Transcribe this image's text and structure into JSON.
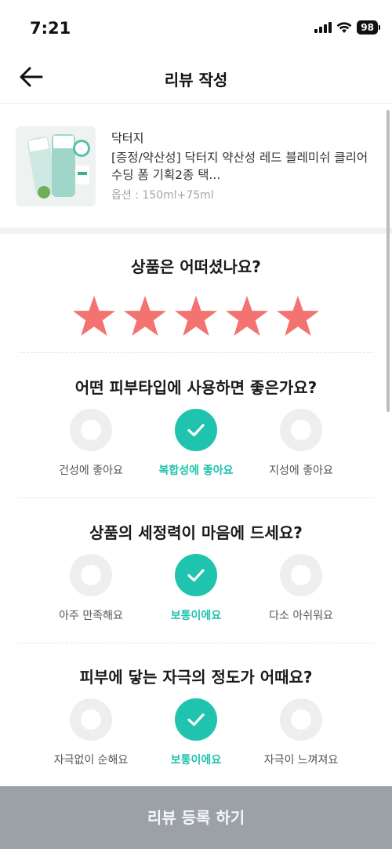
{
  "status": {
    "time": "7:21",
    "battery": "98"
  },
  "header": {
    "title": "리뷰 작성",
    "back_icon": "arrow-left-icon"
  },
  "product": {
    "brand": "닥터지",
    "name": "[증정/약산성] 닥터지 약산성 레드 블레미쉬 클리어 수딩 폼 기획2종 택...",
    "option": "옵션 : 150ml+75ml"
  },
  "rating": {
    "question": "상품은 어떠셨나요?",
    "stars": 5,
    "max_stars": 5,
    "star_color": "#f37370"
  },
  "questions": [
    {
      "question": "어떤 피부타입에 사용하면 좋은가요?",
      "options": [
        "건성에 좋아요",
        "복합성에 좋아요",
        "지성에 좋아요"
      ],
      "selected": 1
    },
    {
      "question": "상품의 세정력이 마음에 드세요?",
      "options": [
        "아주 만족해요",
        "보통이에요",
        "다소 아쉬워요"
      ],
      "selected": 1
    },
    {
      "question": "피부에 닿는 자극의 정도가 어때요?",
      "options": [
        "자극없이 순해요",
        "보통이에요",
        "자극이 느껴져요"
      ],
      "selected": 1
    }
  ],
  "submit_label": "리뷰 등록 하기",
  "colors": {
    "accent": "#1ec2ad",
    "submit_bg": "#9ba1a6"
  }
}
